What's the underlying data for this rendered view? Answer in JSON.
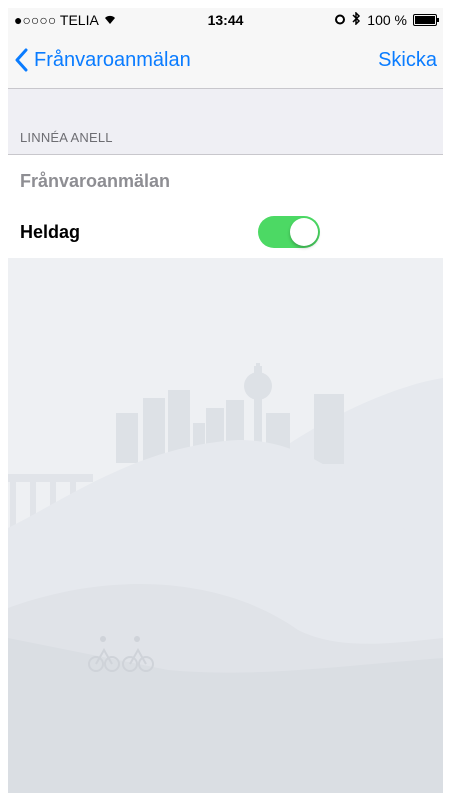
{
  "status_bar": {
    "carrier": "●○○○○ TELIA",
    "wifi_glyph": "⌔",
    "time": "13:44",
    "battery_percent": "100 %",
    "battery_level": 1.0
  },
  "nav": {
    "back_label": "Frånvaroanmälan",
    "action_label": "Skicka"
  },
  "section": {
    "header": "LINNÉA ANELL"
  },
  "fields": {
    "reason_placeholder": "Frånvaroanmälan",
    "allday_label": "Heldag",
    "allday_on": true
  },
  "colors": {
    "accent": "#0a7cff",
    "toggle_on": "#4cd964",
    "background": "#efeff4"
  }
}
